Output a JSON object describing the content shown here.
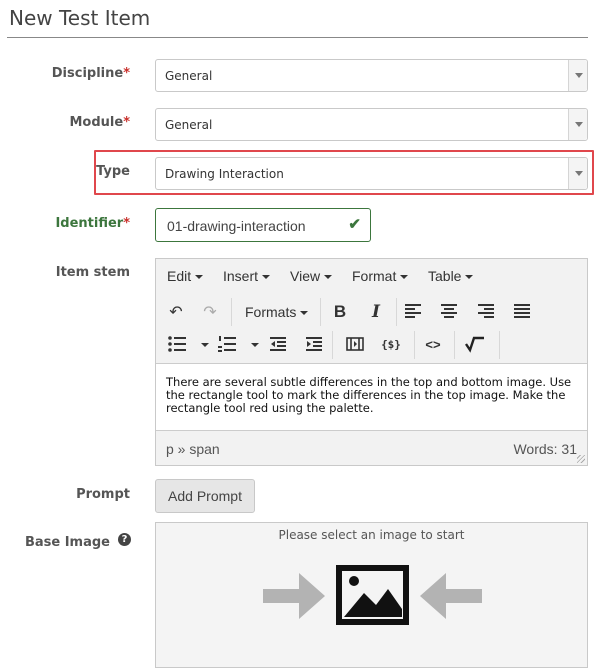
{
  "page": {
    "title": "New Test Item"
  },
  "form": {
    "discipline": {
      "label": "Discipline",
      "required_mark": "*",
      "value": "General"
    },
    "module": {
      "label": "Module",
      "required_mark": "*",
      "value": "General"
    },
    "type": {
      "label": "Type",
      "value": "Drawing Interaction"
    },
    "identifier": {
      "label": "Identifier",
      "required_mark": "*",
      "value": "01-drawing-interaction"
    },
    "item_stem": {
      "label": "Item stem"
    },
    "prompt": {
      "label": "Prompt",
      "button": "Add Prompt"
    },
    "base_image": {
      "label": "Base Image",
      "help": "?",
      "hint": "Please select an image to start"
    }
  },
  "editor": {
    "menus": [
      "Edit",
      "Insert",
      "View",
      "Format",
      "Table"
    ],
    "formats_label": "Formats",
    "content": "There are several subtle differences in the top and bottom image. Use the rectangle tool to mark the differences in the top image. Make the rectangle tool red using the palette.",
    "path": "p » span",
    "word_count": "Words: 31"
  },
  "colors": {
    "required": "#c9302c",
    "success": "#3c763d",
    "highlight": "#e0474c"
  }
}
